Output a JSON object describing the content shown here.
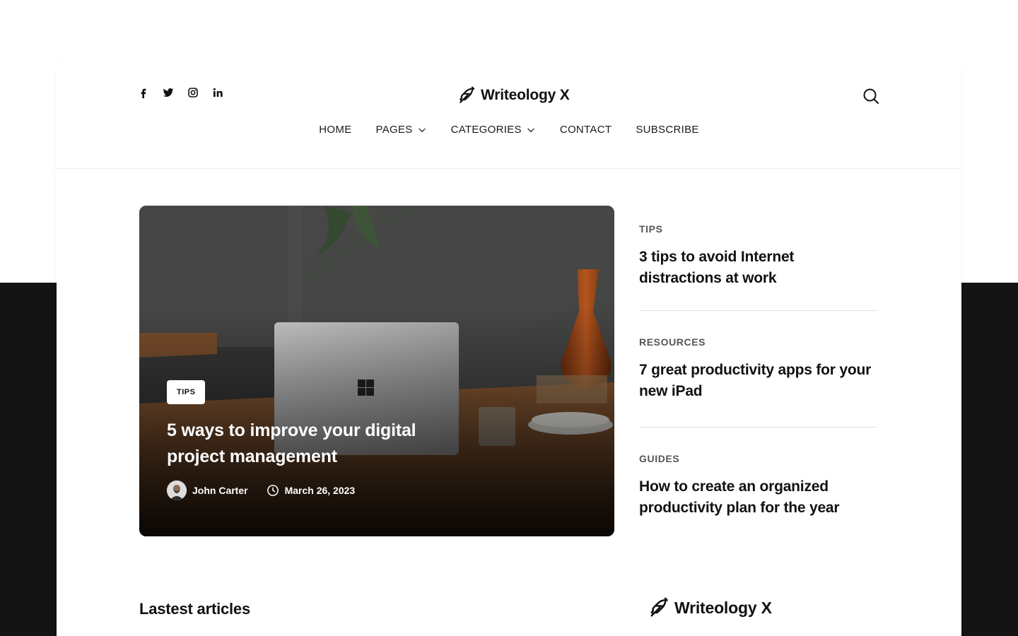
{
  "header": {
    "socials": [
      {
        "icon": "facebook-icon"
      },
      {
        "icon": "twitter-icon"
      },
      {
        "icon": "instagram-icon"
      },
      {
        "icon": "linkedin-icon"
      }
    ],
    "logo_text": "Writeology X",
    "search_icon": "search-icon"
  },
  "nav": {
    "home": "HOME",
    "pages": "PAGES",
    "categories": "CATEGORIES",
    "contact": "CONTACT",
    "subscribe": "SUBSCRIBE"
  },
  "featured": {
    "tag": "TIPS",
    "title": "5 ways to improve your digital project management",
    "author": "John Carter",
    "date": "March 26, 2023"
  },
  "side_posts": [
    {
      "category": "TIPS",
      "title": "3 tips to avoid Internet distractions at work"
    },
    {
      "category": "RESOURCES",
      "title": "7 great productivity apps for your new iPad"
    },
    {
      "category": "GUIDES",
      "title": "How to create an organized productivity plan for the year"
    }
  ],
  "latest": {
    "title": "Lastest articles"
  },
  "footer_logo_text": "Writeology X",
  "colors": {
    "dark_band": "#141414",
    "text": "#111111",
    "muted": "#555555"
  }
}
